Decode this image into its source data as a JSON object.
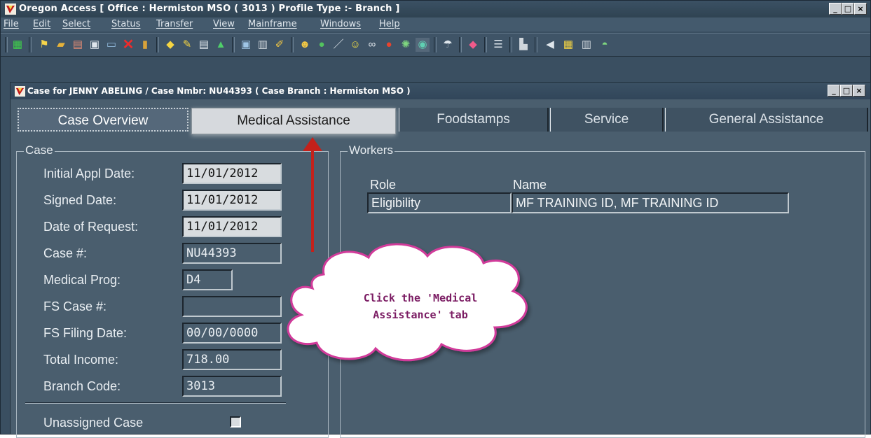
{
  "main_window": {
    "title": "Oregon Access [ Office : Hermiston MSO ( 3013 ) Profile Type :- Branch ]",
    "menu": [
      "File",
      "Edit",
      "Select",
      "Status",
      "Transfer",
      "View",
      "Mainframe",
      "Windows",
      "Help"
    ]
  },
  "toolbar_icons": [
    "calculator-icon",
    "runner-icon",
    "open-folder-icon",
    "cabinet-icon",
    "save-icon",
    "print-icon",
    "delete-icon",
    "exit-door-icon",
    "thumbs-icon",
    "pen-icon",
    "clipboard-icon",
    "triangle-icon",
    "stamp-icon",
    "trash-icon",
    "pencil-icon",
    "search-person-icon",
    "bag-icon",
    "wand-icon",
    "smiley-icon",
    "glasses-icon",
    "apple-icon",
    "sparkle-icon",
    "globe-icon",
    "umbrella-icon",
    "diamond-icon",
    "stack-icon",
    "chart-icon",
    "speaker-icon",
    "grid-icon",
    "book-icon",
    "helmet-icon"
  ],
  "child_window": {
    "title": "Case for JENNY ABELING / Case Nmbr: NU44393 ( Case Branch : Hermiston MSO )"
  },
  "tabs": [
    {
      "label": "Case Overview"
    },
    {
      "label": "Medical Assistance"
    },
    {
      "label": "Foodstamps"
    },
    {
      "label": "Service"
    },
    {
      "label": "General Assistance"
    }
  ],
  "case_group": {
    "label": "Case",
    "fields": [
      {
        "label": "Initial Appl  Date:",
        "value": "11/01/2012"
      },
      {
        "label": "Signed Date:",
        "value": "11/01/2012"
      },
      {
        "label": "Date of Request:",
        "value": "11/01/2012"
      },
      {
        "label": "Case #:",
        "value": "NU44393"
      },
      {
        "label": "Medical Prog:",
        "value": "D4"
      },
      {
        "label": "FS Case #:",
        "value": ""
      },
      {
        "label": "FS Filing Date:",
        "value": "00/00/0000"
      },
      {
        "label": "Total Income:",
        "value": "718.00"
      },
      {
        "label": "Branch Code:",
        "value": "3013"
      }
    ],
    "unassigned_label": "Unassigned Case"
  },
  "workers_group": {
    "label": "Workers",
    "headers": {
      "role": "Role",
      "name": "Name"
    },
    "rows": [
      {
        "role": "Eligibility",
        "name": "MF TRAINING ID, MF TRAINING ID"
      }
    ]
  },
  "callout": {
    "line1": "Click the 'Medical",
    "line2": "Assistance' tab"
  },
  "colors": {
    "arrow": "#c4211b",
    "callout_text": "#7b1c63",
    "window_bg": "#4a5e6e"
  }
}
